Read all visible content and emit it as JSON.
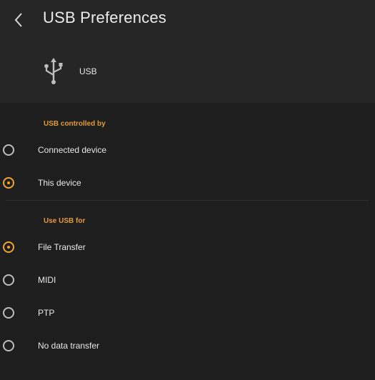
{
  "header": {
    "title": "USB Preferences",
    "back_icon": "chevron-left-icon"
  },
  "device": {
    "icon": "usb-icon",
    "label": "USB"
  },
  "controlled_by": {
    "header": "USB controlled by",
    "options": [
      {
        "label": "Connected device",
        "selected": false
      },
      {
        "label": "This device",
        "selected": true
      }
    ]
  },
  "use_for": {
    "header": "Use USB for",
    "options": [
      {
        "label": "File Transfer",
        "selected": true
      },
      {
        "label": "MIDI",
        "selected": false
      },
      {
        "label": "PTP",
        "selected": false
      },
      {
        "label": "No data transfer",
        "selected": false
      }
    ]
  },
  "colors": {
    "accent": "#f0a433",
    "section_header": "#e39b3b",
    "background": "#1e1e1e",
    "header_background": "#262626"
  }
}
